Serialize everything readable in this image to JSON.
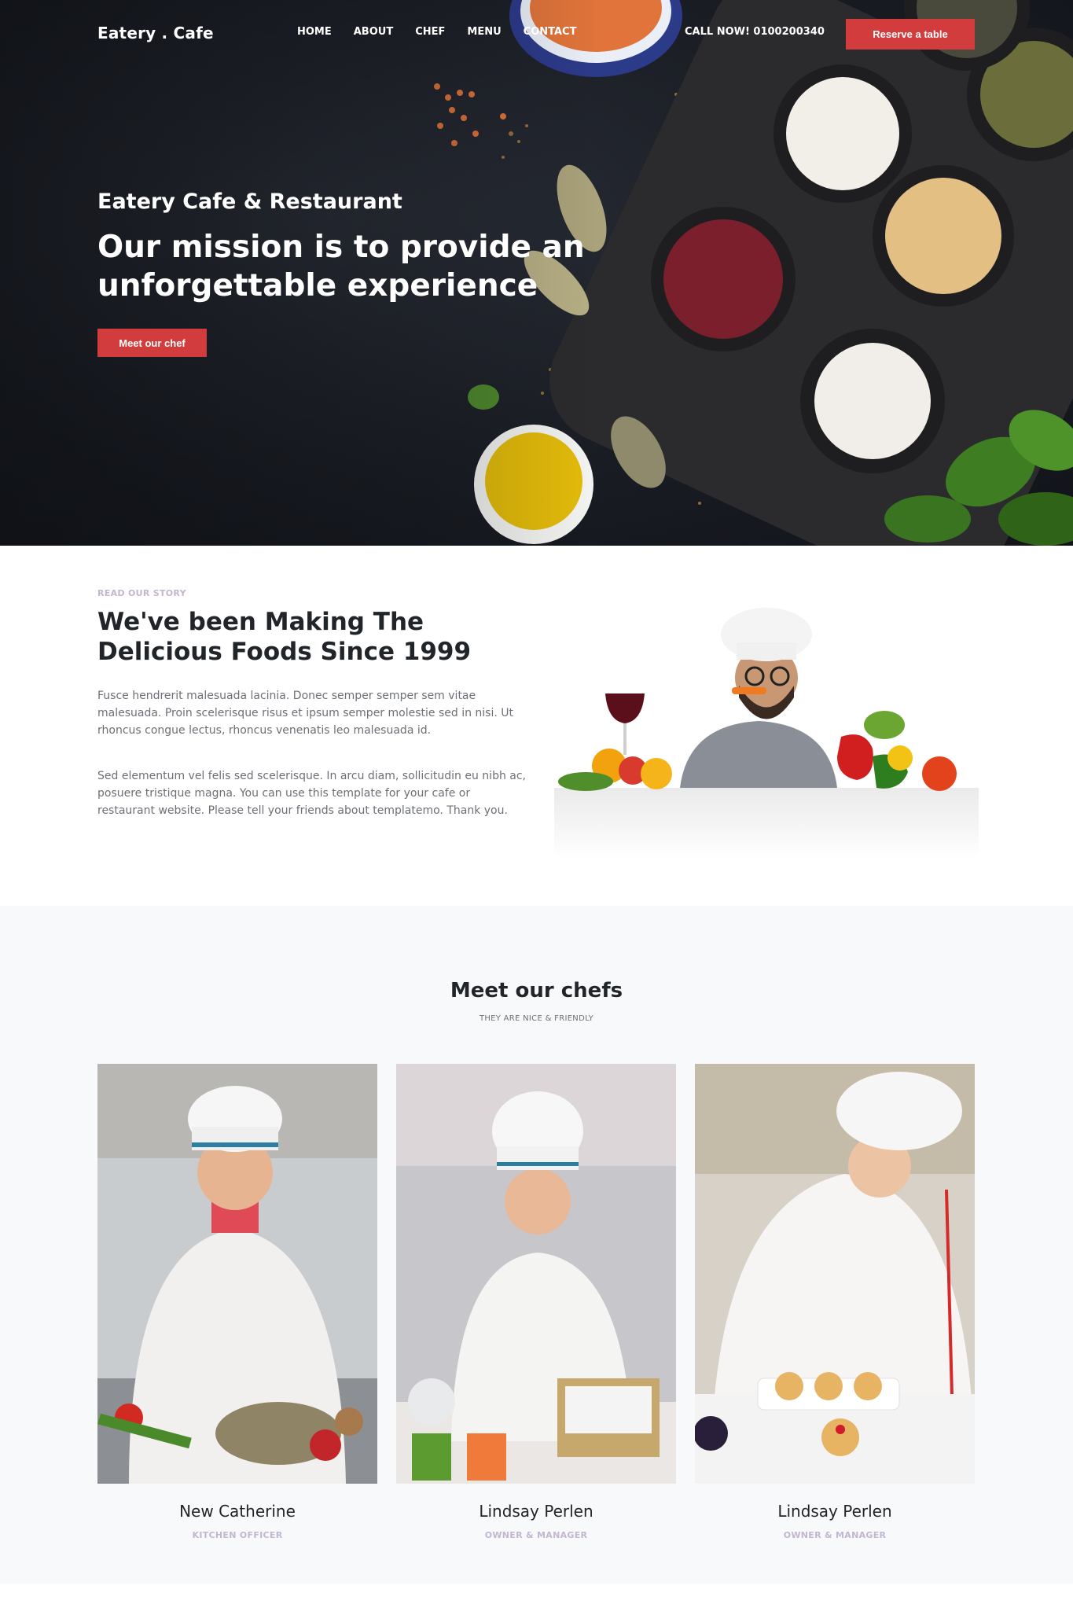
{
  "nav": {
    "brand": "Eatery . Cafe",
    "links": [
      "HOME",
      "ABOUT",
      "CHEF",
      "MENU",
      "CONTACT"
    ],
    "call": "CALL NOW! 0100200340",
    "reserve": "Reserve a table"
  },
  "hero": {
    "subtitle": "Eatery Cafe & Restaurant",
    "title": "Our mission is to provide an unforgettable experience",
    "button": "Meet our chef"
  },
  "story": {
    "eyebrow": "READ OUR STORY",
    "title": "We've been Making The Delicious Foods Since 1999",
    "p1": "Fusce hendrerit malesuada lacinia. Donec semper semper sem vitae malesuada. Proin scelerisque risus et ipsum semper molestie sed in nisi. Ut rhoncus congue lectus, rhoncus venenatis leo malesuada id.",
    "p2": "Sed elementum vel felis sed scelerisque. In arcu diam, sollicitudin eu nibh ac, posuere tristique magna. You can use this template for your cafe or restaurant website. Please tell your friends about templatemo. Thank you."
  },
  "chefs": {
    "title": "Meet our chefs",
    "subtitle": "THEY ARE NICE & FRIENDLY",
    "items": [
      {
        "name": "New Catherine",
        "role": "KITCHEN OFFICER"
      },
      {
        "name": "Lindsay Perlen",
        "role": "OWNER & MANAGER"
      },
      {
        "name": "Lindsay Perlen",
        "role": "OWNER & MANAGER"
      }
    ]
  },
  "colors": {
    "accent": "#d33c3c",
    "hero_bg": "#1a1d24",
    "section_bg": "#f8f9fb",
    "muted": "#c3b6cf"
  }
}
